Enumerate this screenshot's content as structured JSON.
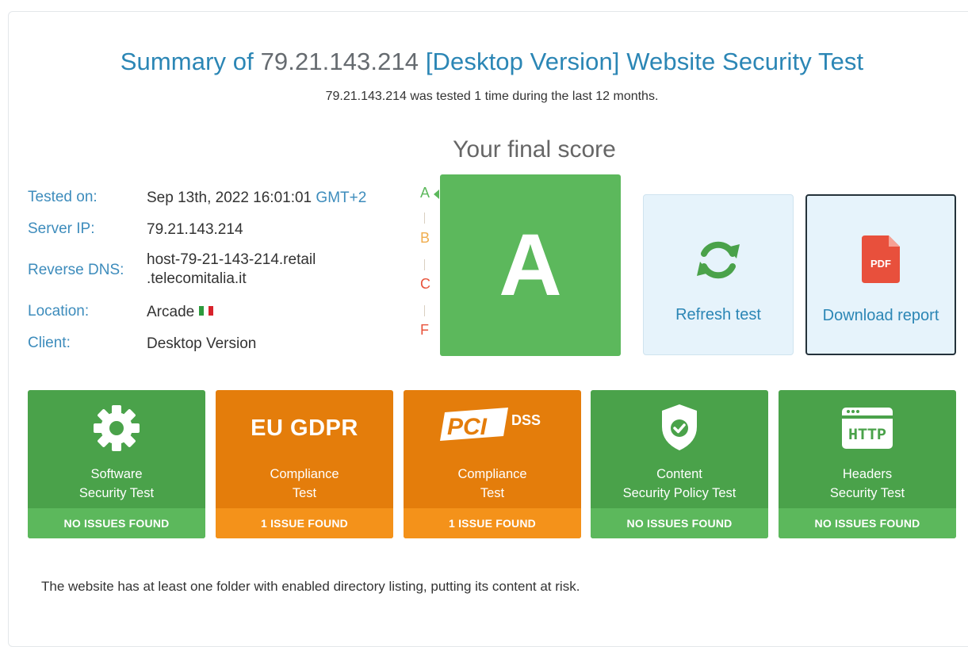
{
  "title": {
    "prefix": "Summary of ",
    "ip": "79.21.143.214",
    "suffix": " [Desktop Version] Website Security Test"
  },
  "subtitle": "79.21.143.214 was tested 1 time during the last 12 months.",
  "score": {
    "heading": "Your final score",
    "grade": "A",
    "scale": [
      "A",
      "B",
      "C",
      "F"
    ],
    "scale_colors": [
      "#5cb85c",
      "#f0ad4e",
      "#e8543c",
      "#e8543c"
    ],
    "grade_color": "#5cb85c"
  },
  "info": {
    "tested_on_label": "Tested on:",
    "tested_on_value": "Sep 13th, 2022 16:01:01",
    "tested_on_tz": "GMT+2",
    "server_ip_label": "Server IP:",
    "server_ip_value": "79.21.143.214",
    "reverse_dns_label": "Reverse DNS:",
    "reverse_dns_line1": "host-79-21-143-214.retail",
    "reverse_dns_line2": ".telecomitalia.it",
    "location_label": "Location:",
    "location_value": "Arcade",
    "location_flag": "italy-flag",
    "client_label": "Client:",
    "client_value": "Desktop Version"
  },
  "actions": {
    "refresh_label": "Refresh test",
    "refresh_icon": "refresh-icon",
    "download_label": "Download report",
    "download_icon": "pdf-icon",
    "pdf_badge": "PDF"
  },
  "tests": [
    {
      "line1": "Software",
      "line2": "Security Test",
      "status": "NO ISSUES FOUND",
      "icon": "gear-icon",
      "color": "green"
    },
    {
      "logo": "EU GDPR",
      "line1": "Compliance",
      "line2": "Test",
      "status": "1 ISSUE FOUND",
      "icon": "gdpr-logo",
      "color": "orange"
    },
    {
      "logo_main": "PCI",
      "logo_sup": "DSS",
      "line1": "Compliance",
      "line2": "Test",
      "status": "1 ISSUE FOUND",
      "icon": "pci-dss-logo",
      "color": "orange"
    },
    {
      "line1": "Content",
      "line2": "Security Policy Test",
      "status": "NO ISSUES FOUND",
      "icon": "shield-check-icon",
      "color": "green"
    },
    {
      "line1": "Headers",
      "line2": "Security Test",
      "status": "NO ISSUES FOUND",
      "icon": "http-browser-icon",
      "http_text": "HTTP",
      "color": "green"
    }
  ],
  "footer_note": "The website has at least one folder with enabled directory listing, putting its content at risk."
}
